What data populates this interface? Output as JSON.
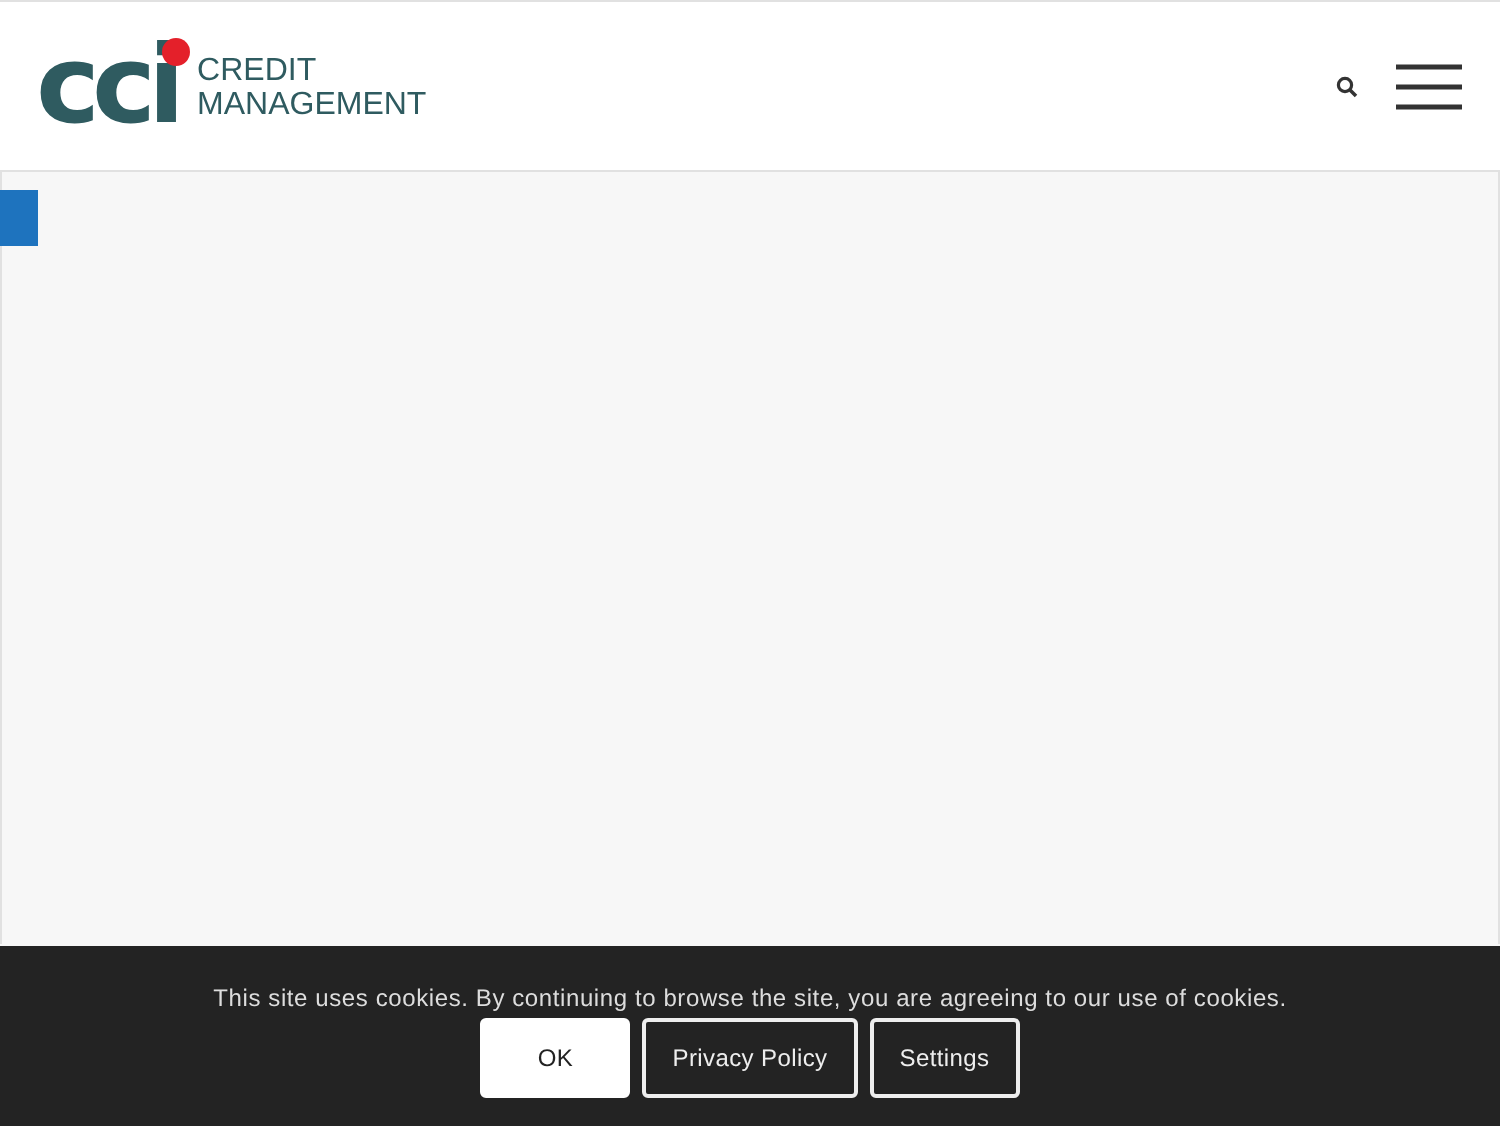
{
  "header": {
    "logo": {
      "mark": "cci",
      "line_1": "CREDIT",
      "line_2": "MANAGEMENT"
    }
  },
  "cookie_bar": {
    "message": "This site uses cookies. By continuing to browse the site, you are agreeing to our use of cookies.",
    "buttons": [
      {
        "label": "OK",
        "kind": "primary"
      },
      {
        "label": "Privacy Policy",
        "kind": "outline"
      },
      {
        "label": "Settings",
        "kind": "outline"
      }
    ]
  }
}
